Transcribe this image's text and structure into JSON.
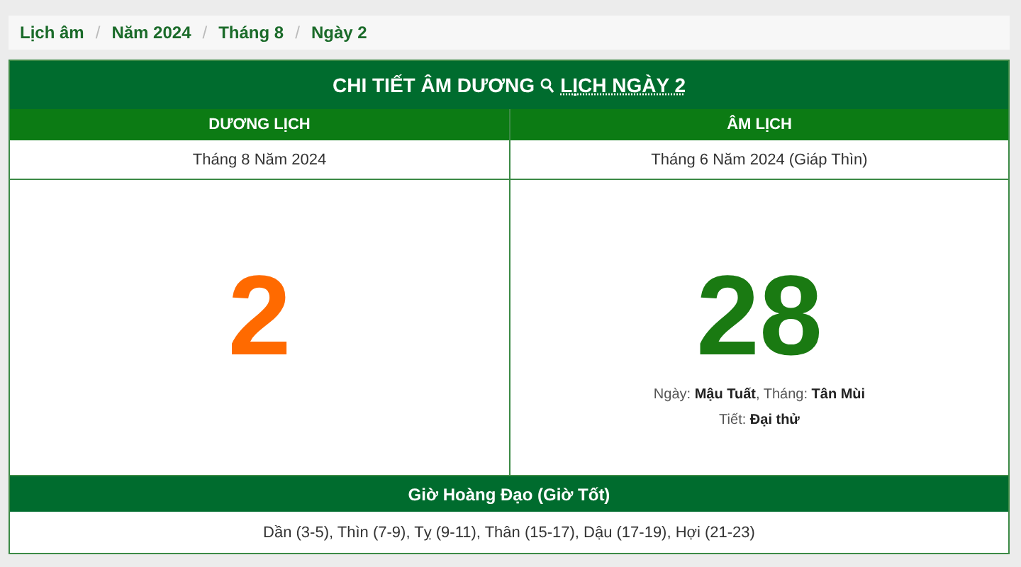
{
  "breadcrumb": {
    "separator": "/",
    "items": [
      "Lịch âm",
      "Năm 2024",
      "Tháng 8",
      "Ngày 2"
    ]
  },
  "title": {
    "before": "CHI TIẾT ÂM DƯƠNG",
    "after": "LỊCH NGÀY 2"
  },
  "columns": [
    {
      "heading": "DƯƠNG LỊCH",
      "month": "Tháng 8 Năm 2024",
      "day": "2",
      "kind": "solar"
    },
    {
      "heading": "ÂM LỊCH",
      "month": "Tháng 6 Năm 2024 (Giáp Thìn)",
      "day": "28",
      "kind": "lunar",
      "lines": [
        "Ngày: **Mậu Tuất**, Tháng: **Tân Mùi**",
        "Tiết: **Đại thử**"
      ]
    }
  ],
  "good_hours": {
    "heading": "Giờ Hoàng Đạo (Giờ Tốt)",
    "text": "Dần (3-5), Thìn (7-9), Tỵ (9-11), Thân (15-17), Dậu (17-19), Hợi (21-23)"
  }
}
